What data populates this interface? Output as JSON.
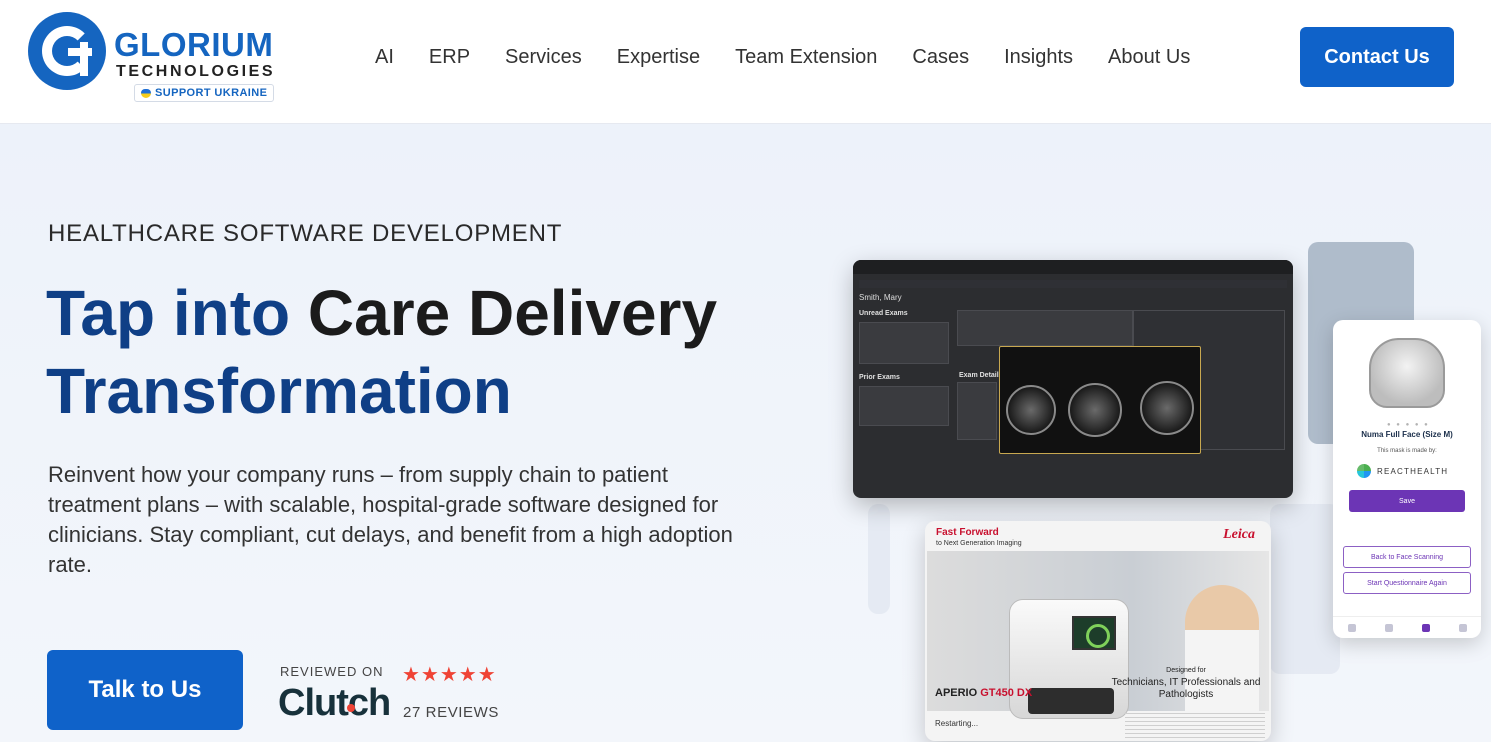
{
  "brand": {
    "name": "GLORIUM",
    "sub": "TECHNOLOGIES",
    "badge": "SUPPORT UKRAINE",
    "primary_color": "#1565c0"
  },
  "nav": {
    "items": [
      "AI",
      "ERP",
      "Services",
      "Expertise",
      "Team Extension",
      "Cases",
      "Insights",
      "About Us"
    ],
    "cta": "Contact Us"
  },
  "hero": {
    "eyebrow": "HEALTHCARE SOFTWARE DEVELOPMENT",
    "headline_blue": "Tap into",
    "headline_rest": "Care Delivery",
    "headline_line2": "Transformation",
    "description": "Reinvent how your company runs – from supply chain to patient treatment plans – with scalable, hospital-grade software designed for clinicians. Stay compliant, cut delays, and benefit from a high adoption rate.",
    "cta": "Talk to Us"
  },
  "clutch": {
    "reviewed_on": "REVIEWED ON",
    "logo": "Clutch",
    "rating": 5,
    "stars": "★★★★★",
    "reviews": "27 REVIEWS"
  },
  "dashboard": {
    "patient": "Smith, Mary",
    "unread": "Unread Exams",
    "prior": "Prior Exams",
    "details": "Exam Details"
  },
  "mobile": {
    "product": "Numa Full Face (Size M)",
    "made_by": "This mask is made by:",
    "brand": "REACTHEALTH",
    "save": "Save",
    "back": "Back to Face Scanning",
    "restart": "Start Questionnaire Again"
  },
  "leica": {
    "fast_forward": "Fast Forward",
    "subtitle": "to Next Generation Imaging",
    "brand": "Leica",
    "model_a": "APERIO",
    "model_b": "GT450 DX",
    "designed_for": "Designed for",
    "roles": "Technicians, IT Professionals and Pathologists",
    "status": "Restarting..."
  }
}
